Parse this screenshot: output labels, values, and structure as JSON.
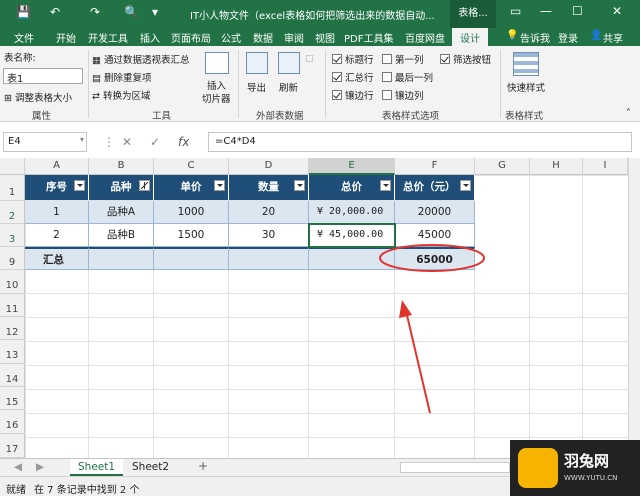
{
  "titlebar": {
    "title": "IT小人物文件（excel表格如何把筛选出来的数据自动...",
    "context_tab": "表格...",
    "minimize": "—",
    "maximize": "☐",
    "close": "✕"
  },
  "tabs": [
    "文件",
    "开始",
    "开发工具",
    "插入",
    "页面布局",
    "公式",
    "数据",
    "审阅",
    "视图",
    "PDF工具集",
    "百度网盘",
    "设计"
  ],
  "tab_right": {
    "tell_me": "告诉我",
    "login": "登录",
    "share": "共享"
  },
  "ribbon": {
    "properties": {
      "name_label": "表名称:",
      "name_value": "表1",
      "resize": "调整表格大小",
      "group": "属性"
    },
    "tools": {
      "pivot": "通过数据透视表汇总",
      "dedupe": "删除重复项",
      "convert": "转换为区域",
      "slicer_1": "插入",
      "slicer_2": "切片器",
      "group": "工具"
    },
    "external": {
      "export": "导出",
      "refresh": "刷新",
      "group": "外部表数据"
    },
    "style_options": {
      "header_row": "标题行",
      "first_col": "第一列",
      "filter_btn": "筛选按钮",
      "total_row": "汇总行",
      "last_col": "最后一列",
      "banded_rows": "镶边行",
      "banded_cols": "镶边列",
      "group": "表格样式选项"
    },
    "styles": {
      "quick": "快速样式",
      "group": "表格样式"
    }
  },
  "formula_bar": {
    "name_box": "E4",
    "cancel": "✕",
    "enter": "✓",
    "fx": "fx",
    "formula": "=C4*D4"
  },
  "columns": [
    "A",
    "B",
    "C",
    "D",
    "E",
    "F",
    "G",
    "H",
    "I"
  ],
  "rows": [
    "1",
    "2",
    "3",
    "9",
    "10",
    "11",
    "12",
    "13",
    "14",
    "15",
    "16",
    "17"
  ],
  "table": {
    "headers": [
      "序号",
      "品种",
      "单价",
      "数量",
      "总价",
      "总价（元）"
    ],
    "data": [
      [
        "1",
        "品种A",
        "1000",
        "20",
        "¥  20,000.00",
        "20000"
      ],
      [
        "2",
        "品种B",
        "1500",
        "30",
        "¥  45,000.00",
        "45000"
      ],
      [
        "汇总",
        "",
        "",
        "",
        "",
        "65000"
      ]
    ]
  },
  "sheets": [
    "Sheet1",
    "Sheet2"
  ],
  "add_sheet": "+",
  "status": {
    "ready": "就绪",
    "filter_info": "在 7 条记录中找到 2 个"
  },
  "colors": {
    "excel_green": "#217346",
    "table_header": "#1f4e79",
    "band": "#dce6f1",
    "annotation": "#e0342f"
  },
  "watermark": {
    "brand": "羽兔网",
    "url": "WWW.YUTU.CN"
  }
}
